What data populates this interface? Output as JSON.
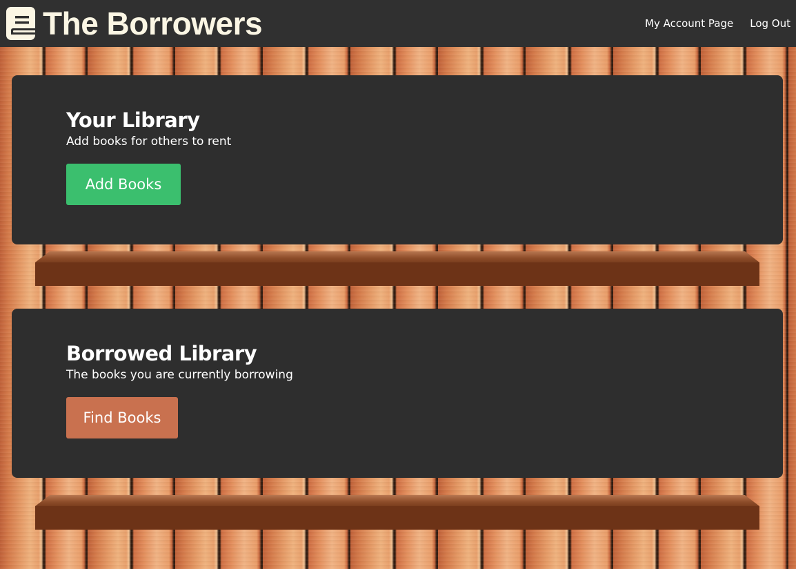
{
  "header": {
    "title": "The Borrowers",
    "logo_icon": "book-icon",
    "nav": [
      {
        "label": "My Account Page"
      },
      {
        "label": "Log Out"
      }
    ]
  },
  "cards": [
    {
      "title": "Your Library",
      "subtitle": "Add books for others to rent",
      "button_label": "Add Books",
      "button_color": "#3bbf6e"
    },
    {
      "title": "Borrowed Library",
      "subtitle": "The books you are currently borrowing",
      "button_label": "Find Books",
      "button_color": "#c9714f"
    }
  ],
  "colors": {
    "header_bg": "#303030",
    "card_bg": "#2e2e2e",
    "title_cream": "#fbf6e4",
    "shelf": "#6d3317"
  }
}
